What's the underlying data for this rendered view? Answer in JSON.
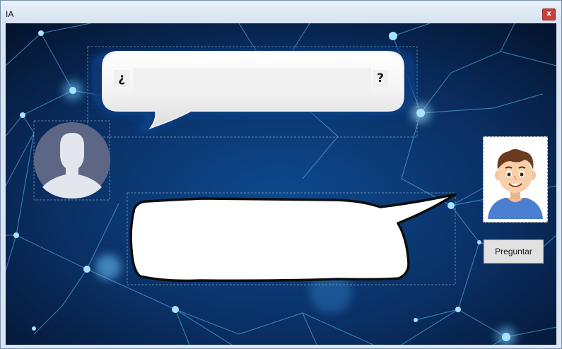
{
  "window": {
    "title": "IA",
    "close_label": "x"
  },
  "question": {
    "open_mark": "¿",
    "close_mark": "?",
    "value": ""
  },
  "answer": {
    "text": ""
  },
  "ask_button": {
    "label": "Preguntar"
  },
  "colors": {
    "background_dark": "#04122b",
    "background_glow": "#0d4a8f",
    "network_line": "#5fb8f0",
    "user_avatar_bg": "#5d6685",
    "user_avatar_fg": "#e3e6ec",
    "close_button": "#c9403a"
  },
  "icons": {
    "user_avatar": "user-silhouette-icon",
    "bot_avatar": "cartoon-boy-avatar-icon",
    "close": "close-icon"
  }
}
